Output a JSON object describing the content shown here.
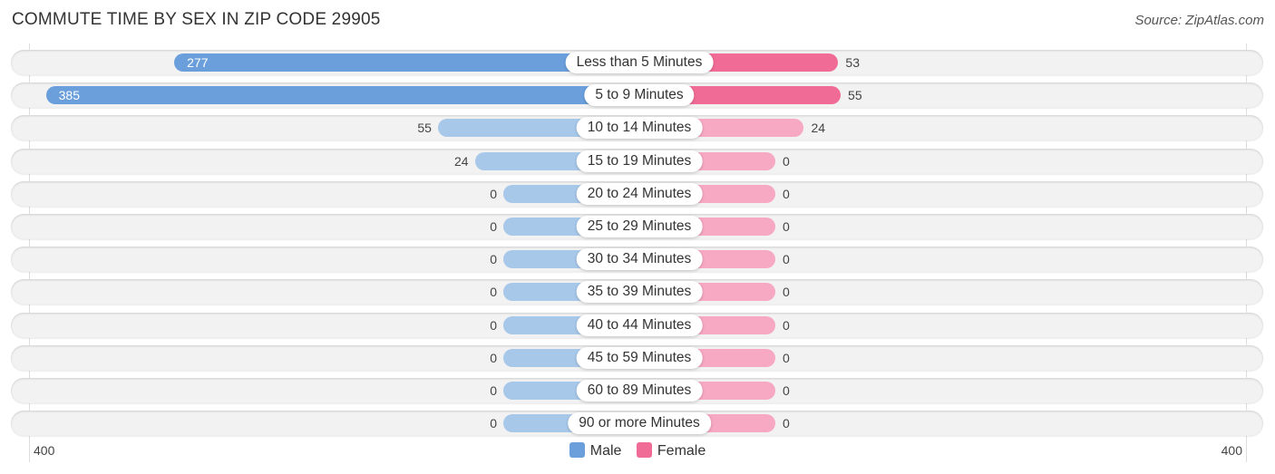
{
  "chart_data": {
    "type": "bar",
    "title": "COMMUTE TIME BY SEX IN ZIP CODE 29905",
    "source": "Source: ZipAtlas.com",
    "categories": [
      "Less than 5 Minutes",
      "5 to 9 Minutes",
      "10 to 14 Minutes",
      "15 to 19 Minutes",
      "20 to 24 Minutes",
      "25 to 29 Minutes",
      "30 to 34 Minutes",
      "35 to 39 Minutes",
      "40 to 44 Minutes",
      "45 to 59 Minutes",
      "60 to 89 Minutes",
      "90 or more Minutes"
    ],
    "series": [
      {
        "name": "Male",
        "color": "#6a9fdc",
        "values": [
          277,
          385,
          55,
          24,
          0,
          0,
          0,
          0,
          0,
          0,
          0,
          0
        ]
      },
      {
        "name": "Female",
        "color": "#f06b95",
        "values": [
          53,
          55,
          24,
          0,
          0,
          0,
          0,
          0,
          0,
          0,
          0,
          0
        ]
      }
    ],
    "axis": {
      "left_label": "400",
      "right_label": "400",
      "range": [
        0,
        400
      ]
    },
    "legend": {
      "position": "bottom-center",
      "items": [
        "Male",
        "Female"
      ]
    }
  }
}
